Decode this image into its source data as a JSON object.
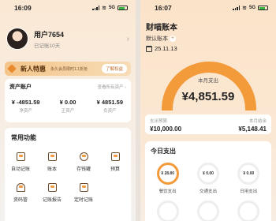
{
  "left": {
    "status": {
      "time": "16:09",
      "network": "5G"
    },
    "profile": {
      "name": "用户7654",
      "days": "已记账10天"
    },
    "banner": {
      "title": "新人特惠",
      "subtitle": "永久会员限时1.1折抢",
      "button": "了解权益"
    },
    "assets": {
      "title": "资产账户",
      "link": "查看所有资产 ›",
      "items": [
        {
          "value": "¥ -4851.59",
          "label": "净资产"
        },
        {
          "value": "¥ 0.00",
          "label": "正资产"
        },
        {
          "value": "¥ 4851.59",
          "label": "负资产"
        }
      ]
    },
    "functions": {
      "title": "常用功能",
      "items": [
        {
          "label": "自动记账",
          "icon": "auto-record-icon"
        },
        {
          "label": "账本",
          "icon": "ledger-icon"
        },
        {
          "label": "存钱罐",
          "icon": "piggy-bank-icon"
        },
        {
          "label": "预算",
          "icon": "budget-icon"
        },
        {
          "label": "资码管",
          "icon": "house-icon"
        },
        {
          "label": "记账报告",
          "icon": "report-icon"
        },
        {
          "label": "定时记账",
          "icon": "calendar-icon"
        }
      ]
    }
  },
  "right": {
    "status": {
      "time": "16:07",
      "network": "5G"
    },
    "title": "财喵账本",
    "book": "默认账本",
    "book_plus": "+",
    "date": "25.11.13",
    "gauge": {
      "label": "本月支出",
      "amount": "¥4,851.59"
    },
    "budget": {
      "budget_label": "支出预算",
      "budget_value": "¥10,000.00",
      "left_label": "本月结余",
      "left_value": "¥5,148.41"
    },
    "today": {
      "title": "今日支出",
      "rings": [
        {
          "value": "¥ 28.80",
          "label": "餐饮支出",
          "active": true
        },
        {
          "value": "¥ 0.00",
          "label": "交通支出",
          "active": false
        },
        {
          "value": "¥ 0.00",
          "label": "日用支出",
          "active": false
        }
      ]
    },
    "colors": {
      "accent": "#f39a3a"
    }
  }
}
